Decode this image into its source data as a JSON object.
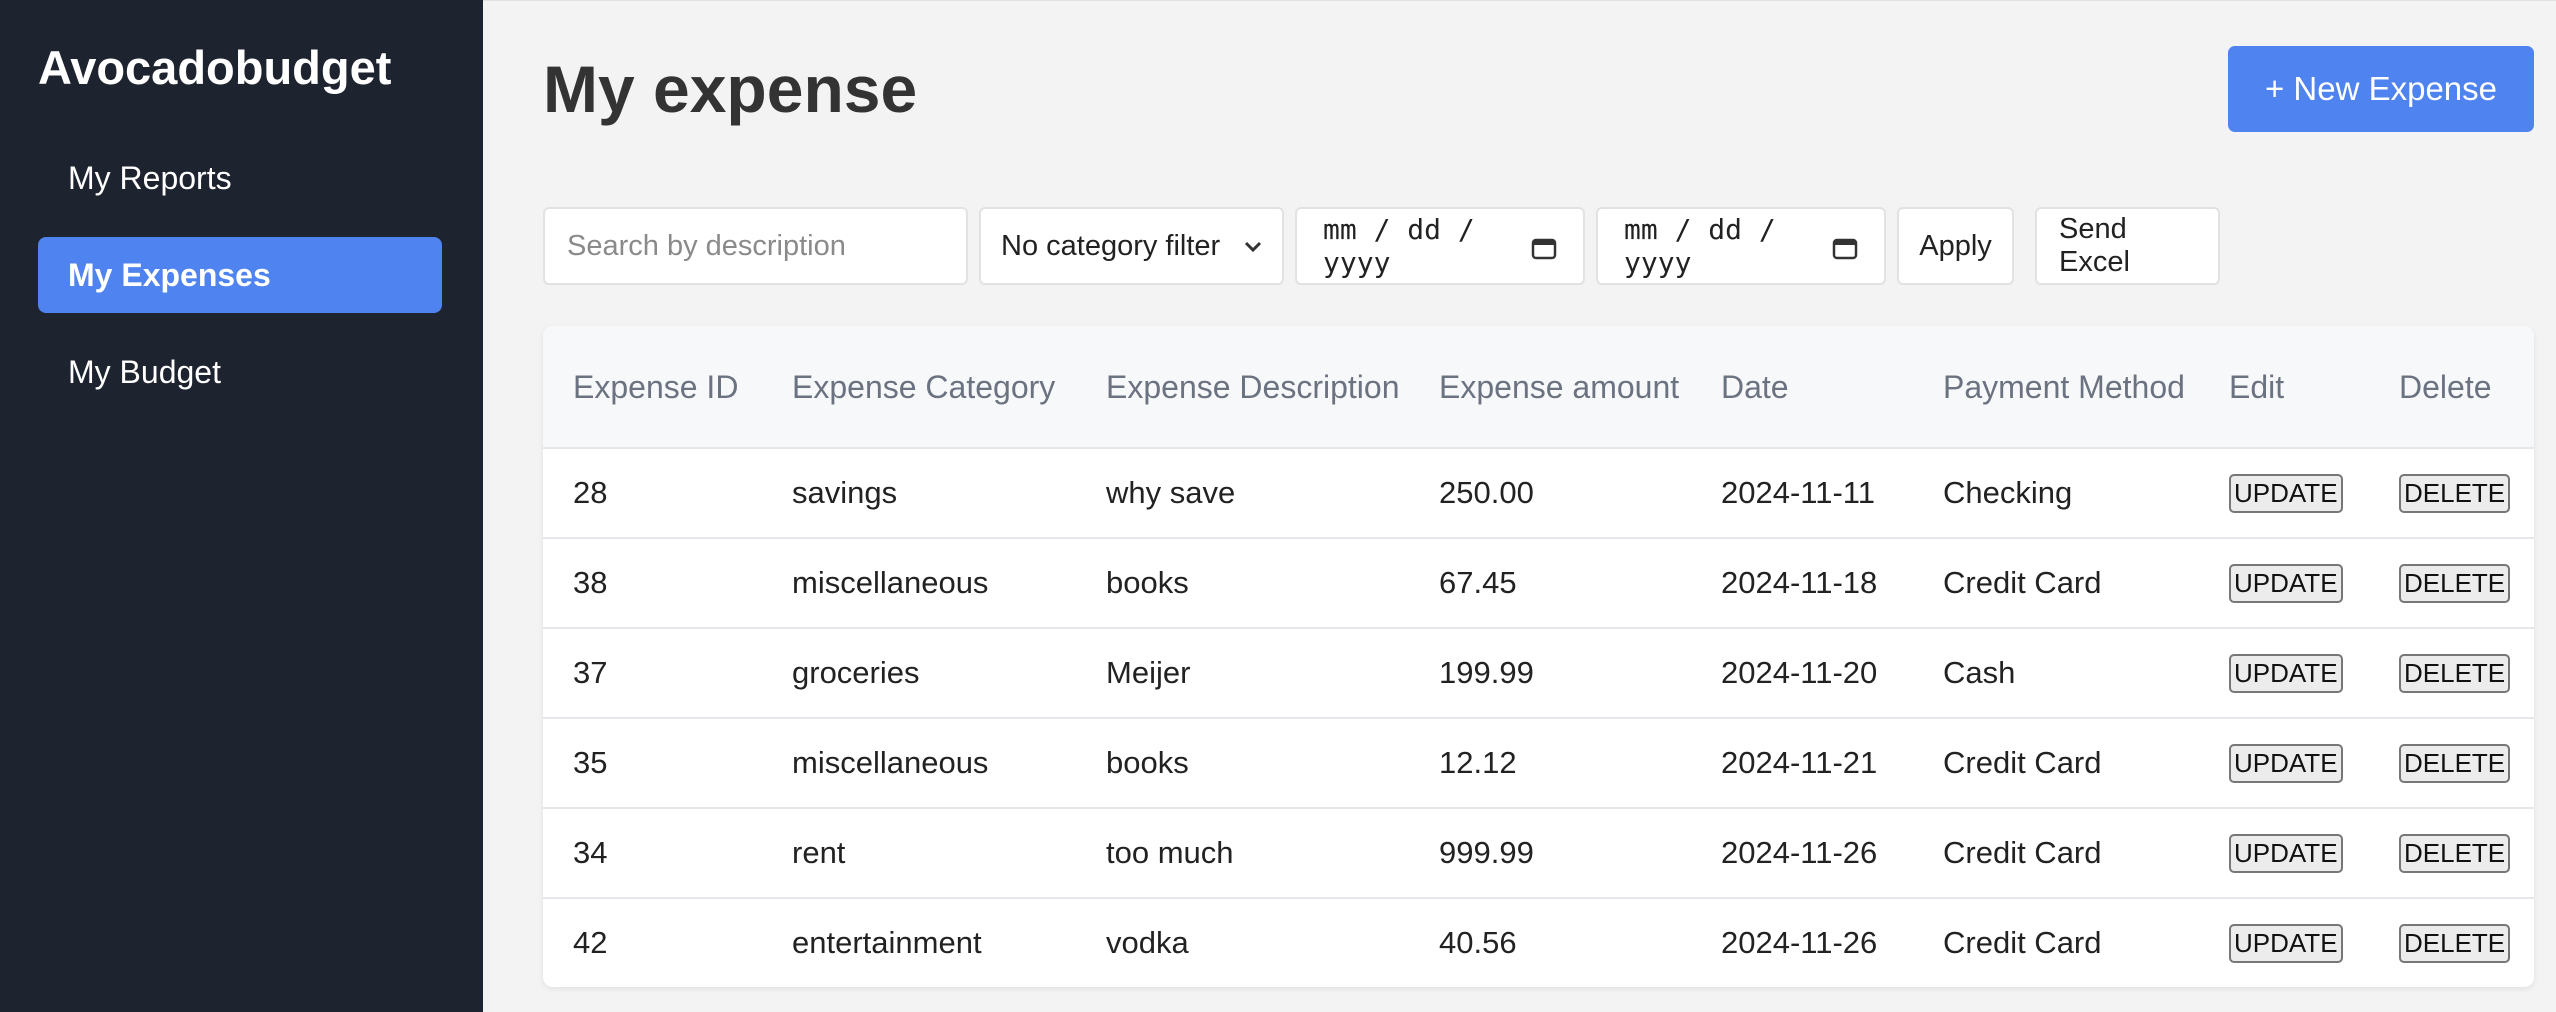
{
  "sidebar": {
    "brand": "Avocadobudget",
    "items": [
      {
        "label": "My Reports",
        "active": false
      },
      {
        "label": "My Expenses",
        "active": true
      },
      {
        "label": "My Budget",
        "active": false
      }
    ]
  },
  "header": {
    "title": "My expense",
    "new_button_label": "+ New Expense"
  },
  "filters": {
    "search_placeholder": "Search by description",
    "category_selected": "No category filter",
    "date_from_placeholder": "mm / dd / yyyy",
    "date_to_placeholder": "mm / dd / yyyy",
    "apply_label": "Apply",
    "excel_label": "Send Excel"
  },
  "table": {
    "headers": [
      "Expense ID",
      "Expense Category",
      "Expense Description",
      "Expense amount",
      "Date",
      "Payment Method",
      "Edit",
      "Delete"
    ],
    "update_label": "UPDATE",
    "delete_label": "DELETE",
    "rows": [
      {
        "id": "28",
        "category": "savings",
        "description": "why save",
        "amount": "250.00",
        "date": "2024-11-11",
        "method": "Checking"
      },
      {
        "id": "38",
        "category": "miscellaneous",
        "description": "books",
        "amount": "67.45",
        "date": "2024-11-18",
        "method": "Credit Card"
      },
      {
        "id": "37",
        "category": "groceries",
        "description": "Meijer",
        "amount": "199.99",
        "date": "2024-11-20",
        "method": "Cash"
      },
      {
        "id": "35",
        "category": "miscellaneous",
        "description": "books",
        "amount": "12.12",
        "date": "2024-11-21",
        "method": "Credit Card"
      },
      {
        "id": "34",
        "category": "rent",
        "description": "too much",
        "amount": "999.99",
        "date": "2024-11-26",
        "method": "Credit Card"
      },
      {
        "id": "42",
        "category": "entertainment",
        "description": "vodka",
        "amount": "40.56",
        "date": "2024-11-26",
        "method": "Credit Card"
      }
    ]
  },
  "colors": {
    "sidebar_bg": "#1e2330",
    "accent": "#4f83ef",
    "page_bg": "#f3f3f3"
  }
}
